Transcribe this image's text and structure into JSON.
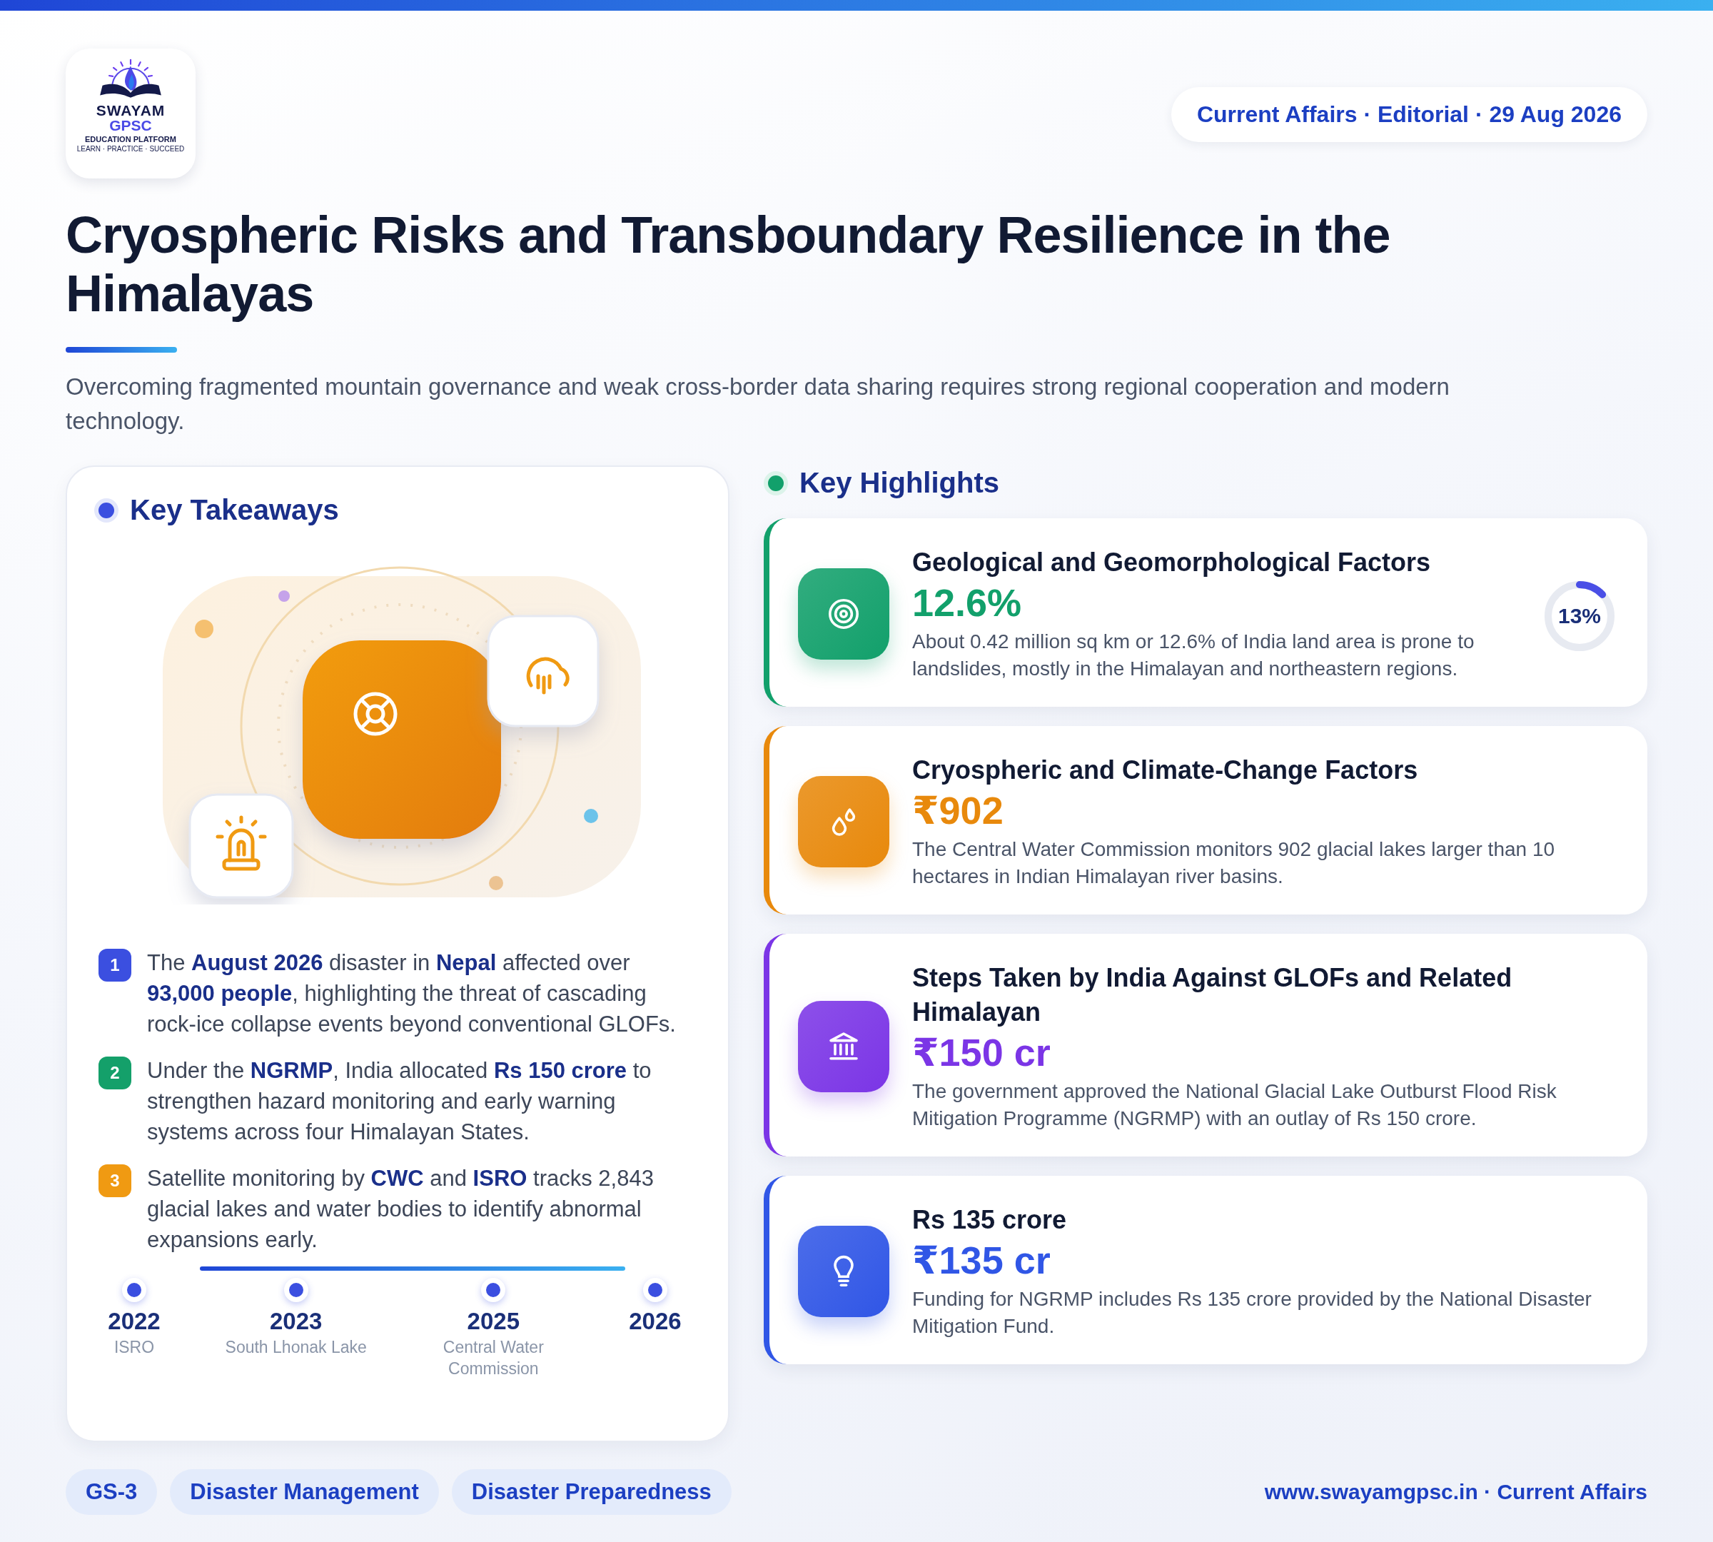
{
  "logo": {
    "name": "SWAYAM",
    "subname": "GPSC",
    "tagline": "EDUCATION PLATFORM",
    "motto": "LEARN · PRACTICE · SUCCEED"
  },
  "date_pill": "Current Affairs · Editorial · 29 Aug 2026",
  "title": "Cryospheric Risks and Transboundary Resilience in the Himalayas",
  "subtitle": "Overcoming fragmented mountain governance and weak cross-border data sharing requires strong regional cooperation and modern technology.",
  "key_takeaways": {
    "heading": "Key Takeaways",
    "items": [
      {
        "number": "1",
        "color": "#3b4fe0",
        "text": "The **August 2026** disaster in **Nepal** affected over **93,000 people**, highlighting the threat of cascading rock-ice collapse events beyond conventional GLOFs."
      },
      {
        "number": "2",
        "color": "#14a06a",
        "text": "Under the **NGRMP**, India allocated **Rs 150 crore** to strengthen hazard monitoring and early warning systems across four Himalayan States."
      },
      {
        "number": "3",
        "color": "#f09a12",
        "text": "Satellite monitoring by **CWC** and **ISRO** tracks 2,843 glacial lakes and water bodies to identify abnormal expansions early."
      }
    ],
    "timeline": [
      {
        "year": "2022",
        "label": "ISRO"
      },
      {
        "year": "2023",
        "label": "South Lhonak Lake"
      },
      {
        "year": "2025",
        "label": "Central Water Commission"
      },
      {
        "year": "2026"
      }
    ]
  },
  "key_highlights": {
    "heading": "Key Highlights",
    "cards": [
      {
        "kind": "target",
        "color": "#12a06b",
        "title": "Geological and Geomorphological Factors",
        "value": "12.6%",
        "description": "About 0.42 million sq km or 12.6% of India land area is prone to landslides, mostly in the Himalayan and northeastern regions.",
        "ring": {
          "label": "13%",
          "level": 0.13
        }
      },
      {
        "kind": "drops",
        "color": "#e8890c",
        "title": "Cryospheric and Climate-Change Factors",
        "value": "₹902",
        "description": "The Central Water Commission monitors 902 glacial lakes larger than 10 hectares in Indian Himalayan river basins."
      },
      {
        "kind": "bank",
        "color": "#7b35e6",
        "title": "Steps Taken by India Against GLOFs and Related Himalayan",
        "value": "₹150 cr",
        "description": "The government approved the National Glacial Lake Outburst Flood Risk Mitigation Programme (NGRMP) with an outlay of Rs 150 crore."
      },
      {
        "kind": "bulb",
        "color": "#3056e6",
        "title": "Rs 135 crore",
        "value": "₹135 cr",
        "description": "Funding for NGRMP includes Rs 135 crore provided by the National Disaster Mitigation Fund."
      }
    ]
  },
  "tags": [
    "GS-3",
    "Disaster Management",
    "Disaster Preparedness"
  ],
  "footer": "www.swayamgpsc.in · Current Affairs"
}
